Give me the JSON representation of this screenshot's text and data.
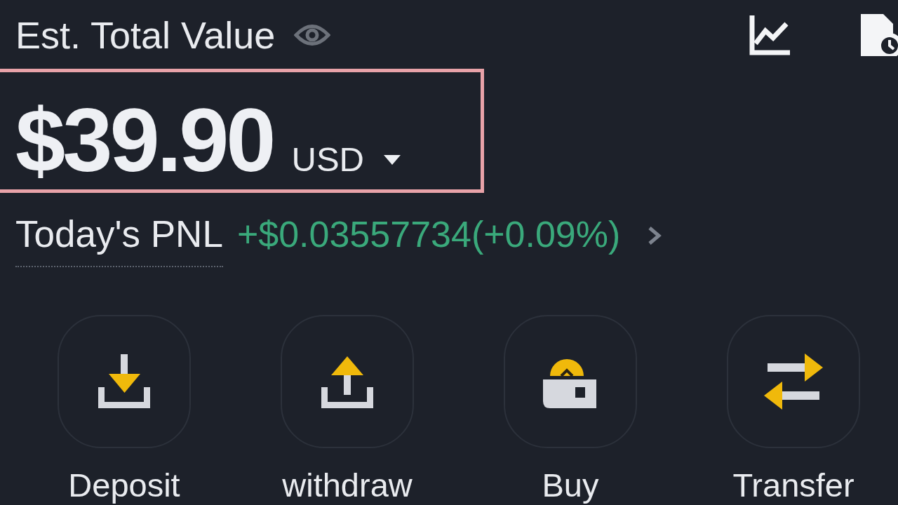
{
  "header": {
    "title": "Est. Total Value"
  },
  "balance": {
    "amount": "$39.90",
    "currency": "USD",
    "highlighted": true
  },
  "pnl": {
    "label": "Today's PNL",
    "value": "+$0.03557734(+0.09%)",
    "positive": true
  },
  "actions": [
    {
      "kind": "deposit",
      "label": "Deposit"
    },
    {
      "kind": "withdraw",
      "label": "withdraw"
    },
    {
      "kind": "buy",
      "label": "Buy"
    },
    {
      "kind": "transfer",
      "label": "Transfer"
    }
  ]
}
